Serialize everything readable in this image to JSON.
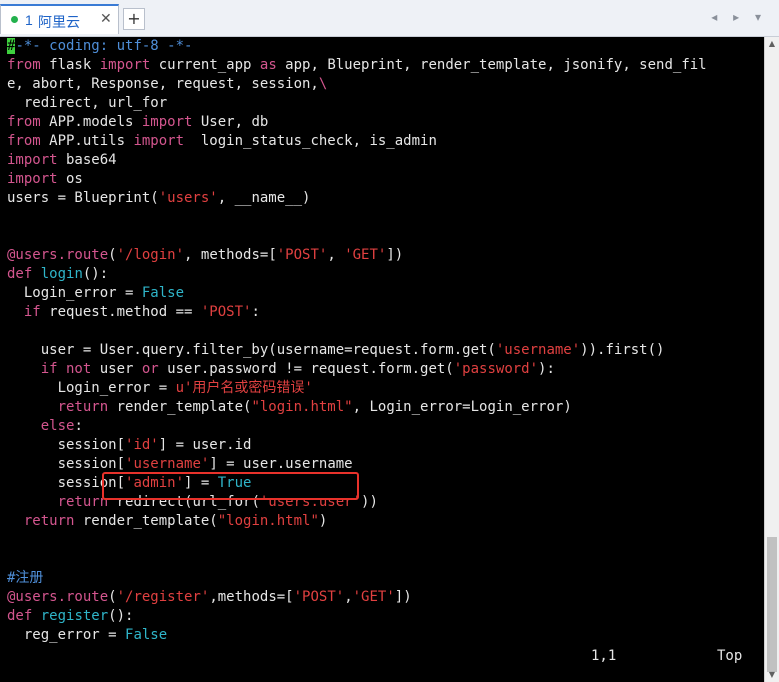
{
  "tab": {
    "number": "1",
    "title": "阿里云",
    "close": "✕",
    "add": "+"
  },
  "nav": {
    "arrows": "◂ ▸ ▾"
  },
  "code_lines": [
    [
      [
        "cursor",
        "#"
      ],
      [
        "cmt",
        "-*- coding: utf-8 -*-"
      ]
    ],
    [
      [
        "kw",
        "from"
      ],
      [
        "",
        "  flask "
      ],
      [
        "kw",
        "import"
      ],
      [
        "",
        "  current_app "
      ],
      [
        "kw",
        "as"
      ],
      [
        "",
        "  app, Blueprint, render_template, jsonify, send_fil"
      ]
    ],
    [
      [
        "",
        "e, abort, Response, request, session,"
      ],
      [
        "kw",
        "\\"
      ]
    ],
    [
      [
        "",
        "    redirect, url_for"
      ]
    ],
    [
      [
        "kw",
        "from"
      ],
      [
        "",
        "  APP.models "
      ],
      [
        "kw",
        "import"
      ],
      [
        "",
        "  User, db"
      ]
    ],
    [
      [
        "kw",
        "from"
      ],
      [
        "",
        "  APP.utils "
      ],
      [
        "kw",
        "import"
      ],
      [
        "",
        "   login_status_check, is_admin"
      ]
    ],
    [
      [
        "kw",
        "import"
      ],
      [
        "",
        "  base64"
      ]
    ],
    [
      [
        "kw",
        "import"
      ],
      [
        "",
        "  os"
      ]
    ],
    [
      [
        "",
        "users = Blueprint("
      ],
      [
        "str",
        "'users'"
      ],
      [
        "",
        ", __name__)"
      ]
    ],
    [
      [
        "",
        ""
      ]
    ],
    [
      [
        "",
        ""
      ]
    ],
    [
      [
        "kw",
        "@users.route"
      ],
      [
        "",
        "("
      ],
      [
        "str",
        "'/login'"
      ],
      [
        "",
        ", methods=["
      ],
      [
        "str",
        "'POST'"
      ],
      [
        "",
        ", "
      ],
      [
        "str",
        "'GET'"
      ],
      [
        "",
        "])"
      ]
    ],
    [
      [
        "kw",
        "def"
      ],
      [
        "",
        ""
      ],
      [
        "const",
        " login"
      ],
      [
        "",
        "():"
      ]
    ],
    [
      [
        "",
        "    Login_error = "
      ],
      [
        "const",
        "False"
      ]
    ],
    [
      [
        "",
        "    "
      ],
      [
        "kw",
        "if"
      ],
      [
        "",
        "  request.method  == "
      ],
      [
        "str",
        "'POST'"
      ],
      [
        "",
        ":"
      ]
    ],
    [
      [
        "",
        ""
      ]
    ],
    [
      [
        "",
        "        user = User.query.filter_by(username=request.form.get("
      ],
      [
        "str",
        "'username'"
      ],
      [
        "",
        ")).first()"
      ]
    ],
    [
      [
        "",
        "        "
      ],
      [
        "kw",
        "if not"
      ],
      [
        "",
        "  user "
      ],
      [
        "kw",
        "or"
      ],
      [
        "",
        "  user.password != request.form.get("
      ],
      [
        "str",
        "'password'"
      ],
      [
        "",
        "):"
      ]
    ],
    [
      [
        "",
        "            Login_error = "
      ],
      [
        "str",
        "u'用户名或密码错误'"
      ]
    ],
    [
      [
        "",
        "            "
      ],
      [
        "kw",
        "return"
      ],
      [
        "",
        "  render_template("
      ],
      [
        "str",
        "\"login.html\""
      ],
      [
        "",
        ", Login_error=Login_error)"
      ]
    ],
    [
      [
        "",
        "        "
      ],
      [
        "kw",
        "else"
      ],
      [
        "",
        ":"
      ]
    ],
    [
      [
        "",
        "            session["
      ],
      [
        "str",
        "'id'"
      ],
      [
        "",
        "] = user.id"
      ]
    ],
    [
      [
        "",
        "            session["
      ],
      [
        "str",
        "'username'"
      ],
      [
        "",
        "] = user.username"
      ]
    ],
    [
      [
        "",
        "            session["
      ],
      [
        "str",
        "'admin'"
      ],
      [
        "",
        "] = "
      ],
      [
        "const",
        "True"
      ]
    ],
    [
      [
        "",
        "            "
      ],
      [
        "kw",
        "return"
      ],
      [
        "",
        "  redirect(url_for("
      ],
      [
        "str",
        "'users.user'"
      ],
      [
        "",
        "))"
      ]
    ],
    [
      [
        "",
        "    "
      ],
      [
        "kw",
        "return"
      ],
      [
        "",
        "  render_template("
      ],
      [
        "str",
        "\"login.html\""
      ],
      [
        "",
        ")"
      ]
    ],
    [
      [
        "",
        ""
      ]
    ],
    [
      [
        "",
        ""
      ]
    ],
    [
      [
        "cmt",
        "#注册"
      ]
    ],
    [
      [
        "kw",
        "@users.route"
      ],
      [
        "",
        "("
      ],
      [
        "str",
        "'/register'"
      ],
      [
        "",
        ",methods=["
      ],
      [
        "str",
        "'POST'"
      ],
      [
        "",
        ","
      ],
      [
        "str",
        "'GET'"
      ],
      [
        "",
        "])"
      ]
    ],
    [
      [
        "kw",
        "def"
      ],
      [
        "",
        ""
      ],
      [
        "const",
        " register"
      ],
      [
        "",
        "():"
      ]
    ],
    [
      [
        "",
        "    reg_error = "
      ],
      [
        "const",
        "False"
      ]
    ]
  ],
  "status": {
    "position": "1,1",
    "location": "Top"
  },
  "colors": {
    "keyword": "#d4568f",
    "string": "#e04040",
    "comment": "#4f8fd9",
    "constant": "#2fb5c9",
    "highlight": "#e8322b"
  }
}
